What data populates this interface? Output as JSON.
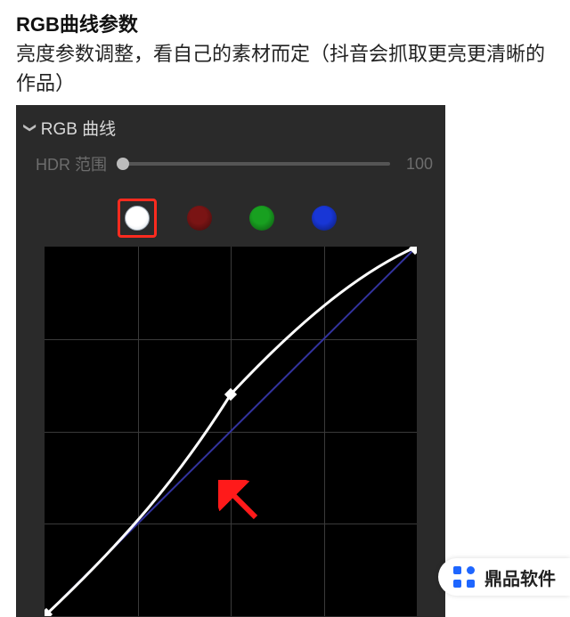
{
  "header": {
    "title": "RGB曲线参数",
    "description": "亮度参数调整，看自己的素材而定（抖音会抓取更亮更清晰的作品）"
  },
  "panel": {
    "section_label": "RGB 曲线",
    "hdr_label": "HDR 范围",
    "hdr_value": "100",
    "swatches": {
      "selected": "white",
      "items": [
        "white",
        "red",
        "green",
        "blue"
      ]
    }
  },
  "chart_data": {
    "type": "line",
    "title": "RGB 曲线",
    "xlabel": "",
    "ylabel": "",
    "xlim": [
      0,
      1
    ],
    "ylim": [
      0,
      1
    ],
    "grid": true,
    "series": [
      {
        "name": "baseline",
        "color": "#3a3a9a",
        "x": [
          0,
          1
        ],
        "y": [
          0,
          1
        ]
      },
      {
        "name": "adjusted-curve",
        "color": "#ffffff",
        "x": [
          0.0,
          0.1,
          0.2,
          0.3,
          0.4,
          0.5,
          0.6,
          0.7,
          0.8,
          0.9,
          1.0
        ],
        "y": [
          0.0,
          0.14,
          0.27,
          0.39,
          0.5,
          0.6,
          0.7,
          0.79,
          0.87,
          0.94,
          1.0
        ],
        "control_point": {
          "x": 0.5,
          "y": 0.6
        }
      }
    ]
  },
  "watermark": {
    "text": "鼎品软件"
  }
}
